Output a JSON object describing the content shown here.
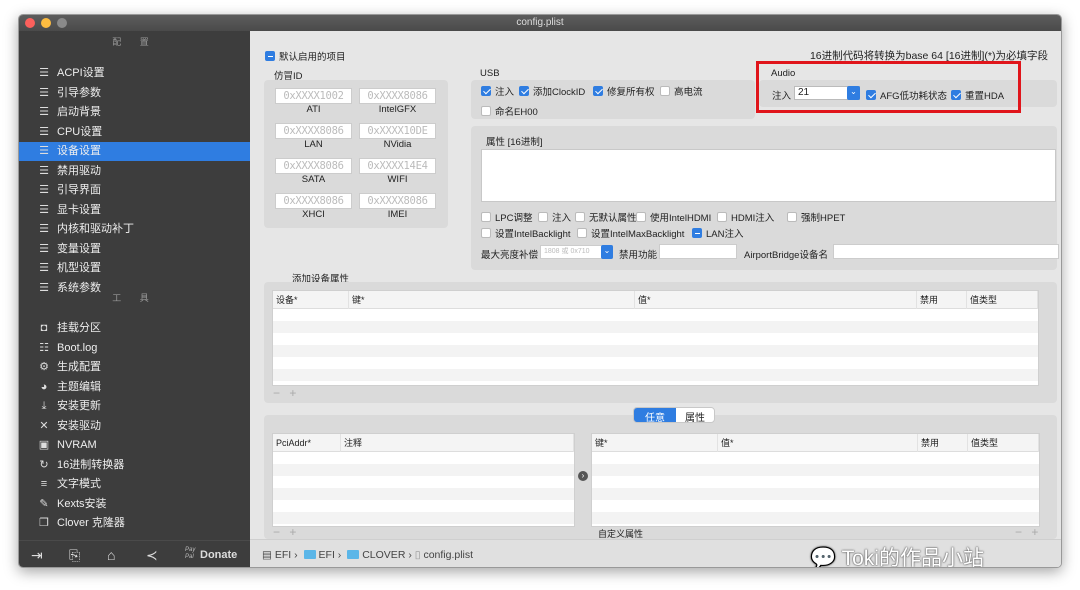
{
  "window": {
    "title": "config.plist"
  },
  "sidebar": {
    "config_header": "配 置",
    "config_items": [
      {
        "label": "ACPI设置",
        "icon": "list-icon"
      },
      {
        "label": "引导参数",
        "icon": "list-icon"
      },
      {
        "label": "启动背景",
        "icon": "list-icon"
      },
      {
        "label": "CPU设置",
        "icon": "list-icon"
      },
      {
        "label": "设备设置",
        "icon": "list-icon",
        "selected": true
      },
      {
        "label": "禁用驱动",
        "icon": "list-icon"
      },
      {
        "label": "引导界面",
        "icon": "list-icon"
      },
      {
        "label": "显卡设置",
        "icon": "list-icon"
      },
      {
        "label": "内核和驱动补丁",
        "icon": "list-icon"
      },
      {
        "label": "变量设置",
        "icon": "list-icon"
      },
      {
        "label": "机型设置",
        "icon": "list-icon"
      },
      {
        "label": "系统参数",
        "icon": "list-icon"
      }
    ],
    "tools_header": "工 具",
    "tool_items": [
      {
        "label": "挂载分区",
        "icon": "disk-icon"
      },
      {
        "label": "Boot.log",
        "icon": "log-search-icon"
      },
      {
        "label": "生成配置",
        "icon": "gears-icon"
      },
      {
        "label": "主题编辑",
        "icon": "palette-icon"
      },
      {
        "label": "安装更新",
        "icon": "download-icon"
      },
      {
        "label": "安装驱动",
        "icon": "tools-icon"
      },
      {
        "label": "NVRAM",
        "icon": "chip-icon"
      },
      {
        "label": "16进制转换器",
        "icon": "refresh-icon"
      },
      {
        "label": "文字模式",
        "icon": "text-icon"
      },
      {
        "label": "Kexts安装",
        "icon": "kext-icon"
      },
      {
        "label": "Clover 克隆器",
        "icon": "clone-icon"
      }
    ],
    "bottom": {
      "donate_label": "Donate",
      "paypal": "Pay Pal"
    }
  },
  "main": {
    "default_enabled": "默认启用的项目",
    "note": "16进制代码将转换为base 64 [16进制](*)为必填字段",
    "fake_id": {
      "title": "仿冒ID",
      "fields": [
        {
          "placeholder": "0xXXXX1002",
          "label": "ATI"
        },
        {
          "placeholder": "0xXXXX8086",
          "label": "IntelGFX"
        },
        {
          "placeholder": "0xXXXX8086",
          "label": "LAN"
        },
        {
          "placeholder": "0xXXXX10DE",
          "label": "NVidia"
        },
        {
          "placeholder": "0xXXXX8086",
          "label": "SATA"
        },
        {
          "placeholder": "0xXXXX14E4",
          "label": "WIFI"
        },
        {
          "placeholder": "0xXXXX8086",
          "label": "XHCI"
        },
        {
          "placeholder": "0xXXXX8086",
          "label": "IMEI"
        }
      ]
    },
    "usb": {
      "title": "USB",
      "options": [
        {
          "label": "注入",
          "checked": true
        },
        {
          "label": "添加ClockID",
          "checked": true
        },
        {
          "label": "修复所有权",
          "checked": true
        },
        {
          "label": "高电流",
          "checked": false
        },
        {
          "label": "命名EH00",
          "checked": false
        }
      ]
    },
    "audio": {
      "title": "Audio",
      "inject_label": "注入",
      "inject_value": "21",
      "afg_label": "AFG低功耗状态",
      "afg_checked": true,
      "reset_label": "重置HDA",
      "reset_checked": true,
      "highlight_color": "#e0151b"
    },
    "properties": {
      "title": "属性 [16进制]",
      "options": [
        {
          "label": "LPC调整",
          "checked": false
        },
        {
          "label": "注入",
          "checked": false
        },
        {
          "label": "无默认属性",
          "checked": false
        },
        {
          "label": "使用IntelHDMI",
          "checked": false
        },
        {
          "label": "HDMI注入",
          "checked": false
        },
        {
          "label": "强制HPET",
          "checked": false
        },
        {
          "label": "设置IntelBacklight",
          "checked": false
        },
        {
          "label": "设置IntelMaxBacklight",
          "checked": false
        },
        {
          "label": "LAN注入",
          "checked": "mixed"
        }
      ],
      "max_brightness_label": "最大亮度补偿",
      "max_brightness_value": "1808 或 0x710",
      "disable_label": "禁用功能",
      "airport_label": "AirportBridge设备名"
    },
    "add_props": {
      "title": "添加设备属性",
      "columns": [
        "设备*",
        "键*",
        "值*",
        "禁用",
        "值类型"
      ]
    },
    "segment": {
      "tabs": [
        "任意",
        "属性"
      ],
      "active": 0
    },
    "custom": {
      "left_columns": [
        "PciAddr*",
        "注释"
      ],
      "right_columns": [
        "键*",
        "值*",
        "禁用",
        "值类型"
      ],
      "caption": "自定义属性"
    },
    "minus_plus": "− +"
  },
  "footer": {
    "path": [
      "EFI",
      "EFI",
      "CLOVER",
      "config.plist"
    ]
  },
  "watermark": "Toki的作品小站",
  "colors": {
    "accent": "#2f7de1",
    "sidebar": "#3d3d3d"
  }
}
